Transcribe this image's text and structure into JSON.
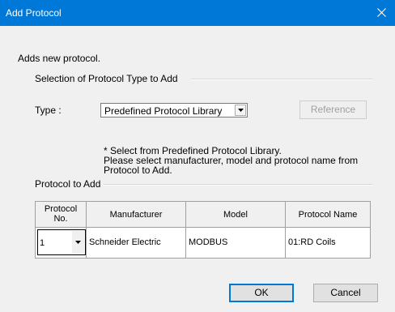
{
  "window": {
    "title": "Add Protocol"
  },
  "intro": "Adds new protocol.",
  "selection_group": {
    "label": "Selection of Protocol Type to Add"
  },
  "type_field": {
    "label": "Type :",
    "value": "Predefined Protocol Library"
  },
  "reference_button": "Reference",
  "note": {
    "line1": "* Select from Predefined Protocol Library.",
    "line2": "Please select manufacturer, model and protocol name from",
    "line3": "Protocol to Add."
  },
  "protocol_group": {
    "label": "Protocol to Add"
  },
  "table": {
    "headers": {
      "no_line1": "Protocol",
      "no_line2": "No.",
      "manufacturer": "Manufacturer",
      "model": "Model",
      "name": "Protocol Name"
    },
    "rows": [
      {
        "no": "1",
        "manufacturer": "Schneider Electric",
        "model": "MODBUS",
        "name": "01:RD Coils"
      }
    ]
  },
  "buttons": {
    "ok": "OK",
    "cancel": "Cancel"
  },
  "icons": {
    "close": "close-icon",
    "dropdown": "chevron-down-icon"
  },
  "colors": {
    "titlebar": "#0078d7",
    "background": "#f0f0f0"
  }
}
